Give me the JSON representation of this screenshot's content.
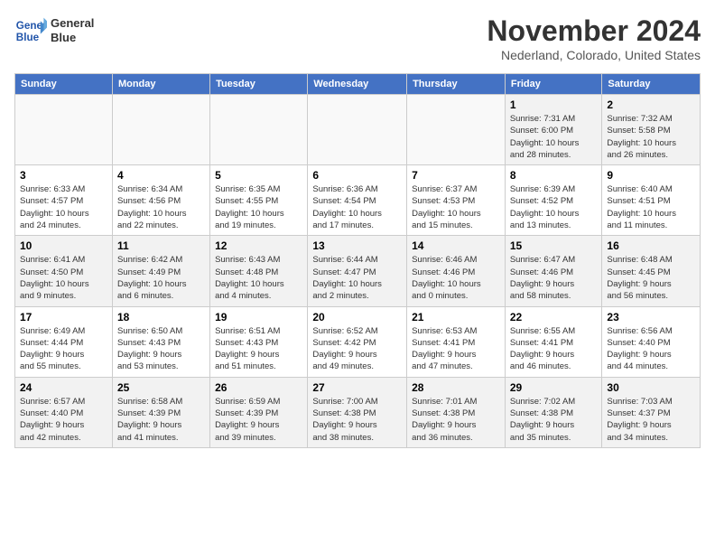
{
  "header": {
    "logo_line1": "General",
    "logo_line2": "Blue",
    "month": "November 2024",
    "location": "Nederland, Colorado, United States"
  },
  "weekdays": [
    "Sunday",
    "Monday",
    "Tuesday",
    "Wednesday",
    "Thursday",
    "Friday",
    "Saturday"
  ],
  "weeks": [
    [
      {
        "day": "",
        "info": ""
      },
      {
        "day": "",
        "info": ""
      },
      {
        "day": "",
        "info": ""
      },
      {
        "day": "",
        "info": ""
      },
      {
        "day": "",
        "info": ""
      },
      {
        "day": "1",
        "info": "Sunrise: 7:31 AM\nSunset: 6:00 PM\nDaylight: 10 hours\nand 28 minutes."
      },
      {
        "day": "2",
        "info": "Sunrise: 7:32 AM\nSunset: 5:58 PM\nDaylight: 10 hours\nand 26 minutes."
      }
    ],
    [
      {
        "day": "3",
        "info": "Sunrise: 6:33 AM\nSunset: 4:57 PM\nDaylight: 10 hours\nand 24 minutes."
      },
      {
        "day": "4",
        "info": "Sunrise: 6:34 AM\nSunset: 4:56 PM\nDaylight: 10 hours\nand 22 minutes."
      },
      {
        "day": "5",
        "info": "Sunrise: 6:35 AM\nSunset: 4:55 PM\nDaylight: 10 hours\nand 19 minutes."
      },
      {
        "day": "6",
        "info": "Sunrise: 6:36 AM\nSunset: 4:54 PM\nDaylight: 10 hours\nand 17 minutes."
      },
      {
        "day": "7",
        "info": "Sunrise: 6:37 AM\nSunset: 4:53 PM\nDaylight: 10 hours\nand 15 minutes."
      },
      {
        "day": "8",
        "info": "Sunrise: 6:39 AM\nSunset: 4:52 PM\nDaylight: 10 hours\nand 13 minutes."
      },
      {
        "day": "9",
        "info": "Sunrise: 6:40 AM\nSunset: 4:51 PM\nDaylight: 10 hours\nand 11 minutes."
      }
    ],
    [
      {
        "day": "10",
        "info": "Sunrise: 6:41 AM\nSunset: 4:50 PM\nDaylight: 10 hours\nand 9 minutes."
      },
      {
        "day": "11",
        "info": "Sunrise: 6:42 AM\nSunset: 4:49 PM\nDaylight: 10 hours\nand 6 minutes."
      },
      {
        "day": "12",
        "info": "Sunrise: 6:43 AM\nSunset: 4:48 PM\nDaylight: 10 hours\nand 4 minutes."
      },
      {
        "day": "13",
        "info": "Sunrise: 6:44 AM\nSunset: 4:47 PM\nDaylight: 10 hours\nand 2 minutes."
      },
      {
        "day": "14",
        "info": "Sunrise: 6:46 AM\nSunset: 4:46 PM\nDaylight: 10 hours\nand 0 minutes."
      },
      {
        "day": "15",
        "info": "Sunrise: 6:47 AM\nSunset: 4:46 PM\nDaylight: 9 hours\nand 58 minutes."
      },
      {
        "day": "16",
        "info": "Sunrise: 6:48 AM\nSunset: 4:45 PM\nDaylight: 9 hours\nand 56 minutes."
      }
    ],
    [
      {
        "day": "17",
        "info": "Sunrise: 6:49 AM\nSunset: 4:44 PM\nDaylight: 9 hours\nand 55 minutes."
      },
      {
        "day": "18",
        "info": "Sunrise: 6:50 AM\nSunset: 4:43 PM\nDaylight: 9 hours\nand 53 minutes."
      },
      {
        "day": "19",
        "info": "Sunrise: 6:51 AM\nSunset: 4:43 PM\nDaylight: 9 hours\nand 51 minutes."
      },
      {
        "day": "20",
        "info": "Sunrise: 6:52 AM\nSunset: 4:42 PM\nDaylight: 9 hours\nand 49 minutes."
      },
      {
        "day": "21",
        "info": "Sunrise: 6:53 AM\nSunset: 4:41 PM\nDaylight: 9 hours\nand 47 minutes."
      },
      {
        "day": "22",
        "info": "Sunrise: 6:55 AM\nSunset: 4:41 PM\nDaylight: 9 hours\nand 46 minutes."
      },
      {
        "day": "23",
        "info": "Sunrise: 6:56 AM\nSunset: 4:40 PM\nDaylight: 9 hours\nand 44 minutes."
      }
    ],
    [
      {
        "day": "24",
        "info": "Sunrise: 6:57 AM\nSunset: 4:40 PM\nDaylight: 9 hours\nand 42 minutes."
      },
      {
        "day": "25",
        "info": "Sunrise: 6:58 AM\nSunset: 4:39 PM\nDaylight: 9 hours\nand 41 minutes."
      },
      {
        "day": "26",
        "info": "Sunrise: 6:59 AM\nSunset: 4:39 PM\nDaylight: 9 hours\nand 39 minutes."
      },
      {
        "day": "27",
        "info": "Sunrise: 7:00 AM\nSunset: 4:38 PM\nDaylight: 9 hours\nand 38 minutes."
      },
      {
        "day": "28",
        "info": "Sunrise: 7:01 AM\nSunset: 4:38 PM\nDaylight: 9 hours\nand 36 minutes."
      },
      {
        "day": "29",
        "info": "Sunrise: 7:02 AM\nSunset: 4:38 PM\nDaylight: 9 hours\nand 35 minutes."
      },
      {
        "day": "30",
        "info": "Sunrise: 7:03 AM\nSunset: 4:37 PM\nDaylight: 9 hours\nand 34 minutes."
      }
    ]
  ]
}
